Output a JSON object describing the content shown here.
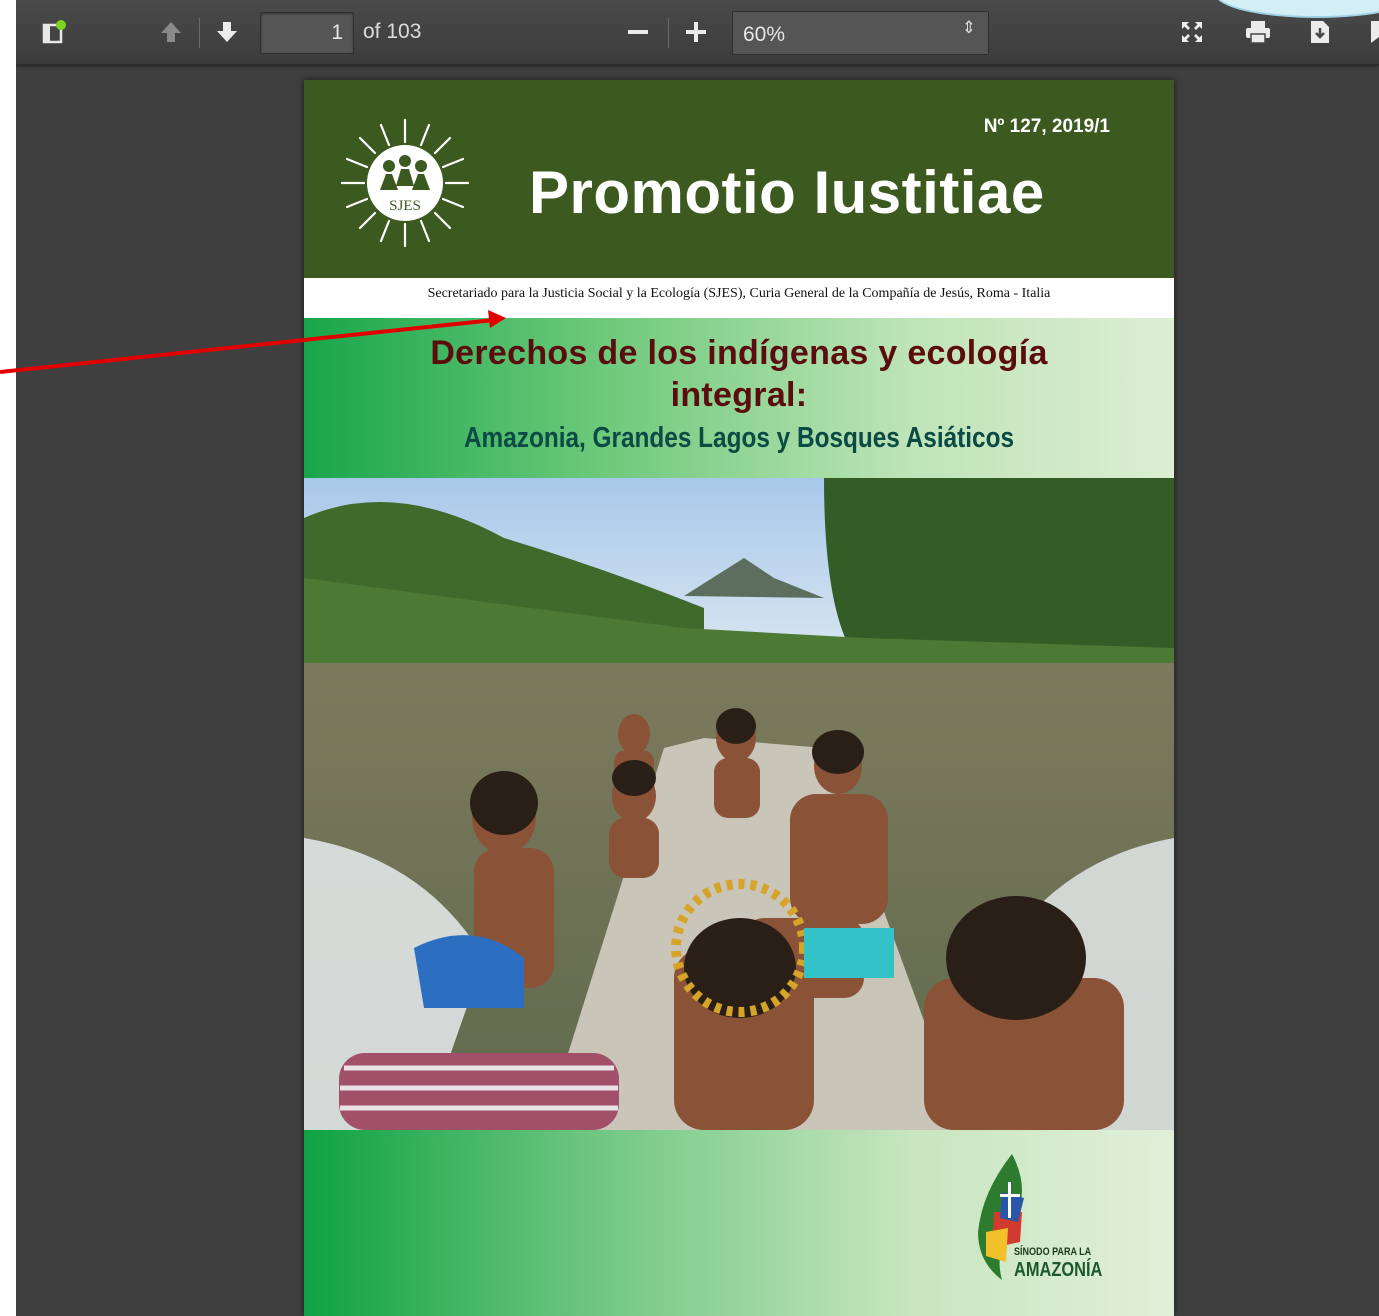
{
  "toolbar": {
    "sidebar_toggle_icon": "sidebar-toggle-icon",
    "prev_page_icon": "arrow-up-icon",
    "next_page_icon": "arrow-down-icon",
    "page_number": "1",
    "page_count": "of 103",
    "zoom_out_icon": "minus-icon",
    "zoom_in_icon": "plus-icon",
    "zoom_value": "60%",
    "zoom_arrow": "⇕",
    "presentation_icon": "fullscreen-icon",
    "print_icon": "printer-icon",
    "download_icon": "download-icon",
    "bookmark_icon": "bookmark-icon"
  },
  "document": {
    "issue": "Nº 127, 2019/1",
    "logo_text": "SJES",
    "title": "Promotio Iustitiae",
    "publisher": "Secretariado para la Justicia Social y la Ecología (SJES), Curia General de la Compañía de Jesús, Roma - Italia",
    "headline_line1": "Derechos de los indígenas y ecología",
    "headline_line2": "integral:",
    "subheadline": "Amazonia, Grandes Lagos y Bosques Asiáticos",
    "synod_line1": "SÍNODO PARA LA",
    "synod_line2": "AMAZONÍA"
  },
  "colors": {
    "viewer_bg": "#3f3f3f",
    "toolbar_bg": "#474747",
    "header_green": "#3c5a1f",
    "headline_red": "#5b0d0d",
    "subheadline_teal": "#0b4a45",
    "annotation_arrow": "#e00000"
  }
}
